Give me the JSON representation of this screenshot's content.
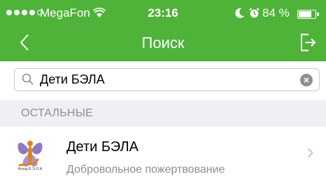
{
  "status_bar": {
    "carrier": "MegaFon",
    "time": "23:16",
    "battery": "84 %",
    "battery_level": 0.84
  },
  "nav": {
    "title": "Поиск"
  },
  "search": {
    "value": "Дети БЭЛА"
  },
  "section": {
    "label": "ОСТАЛЬНЫЕ"
  },
  "results": [
    {
      "title": "Дети БЭЛА",
      "subtitle": "Добровольное пожертвование",
      "logo_text": "Фонд Б.Э.Л.А"
    }
  ],
  "colors": {
    "header": "#4fb33a",
    "section_background": "#efeff4",
    "secondary_text": "#8e8e93"
  }
}
